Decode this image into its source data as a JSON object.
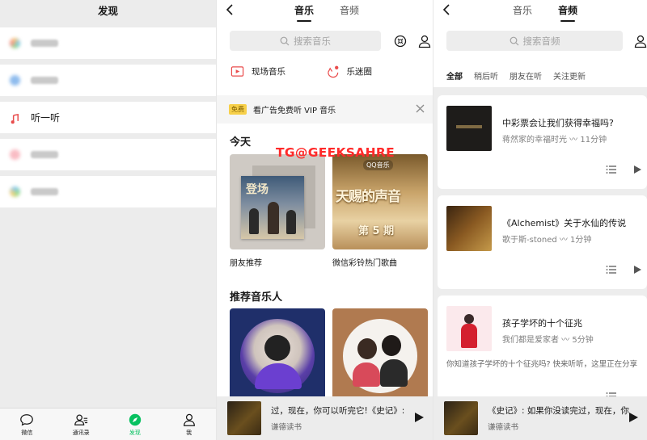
{
  "panel1": {
    "title": "发现",
    "row_label": "听一听",
    "tabbar": [
      {
        "label": "微信"
      },
      {
        "label": "通讯录"
      },
      {
        "label": "发现"
      },
      {
        "label": "我"
      }
    ]
  },
  "panel2": {
    "tabs": [
      "音乐",
      "音频"
    ],
    "search_placeholder": "搜索音乐",
    "quick": [
      "现场音乐",
      "乐迷圈"
    ],
    "ad": {
      "badge": "免费",
      "text": "看广告免费听 VIP 音乐"
    },
    "today_title": "今天",
    "cards": [
      {
        "label": "朋友推荐",
        "cover_text": "登场"
      },
      {
        "label": "微信彩铃热门歌曲",
        "cover_text": "天赐的声音",
        "cover_sub": "第 5 期",
        "cover_logo": "QQ音乐"
      }
    ],
    "artists_title": "推荐音乐人",
    "watermark": "TG@GEEKSAHRE",
    "player": {
      "title": "过，现在，你可以听完它!《史记》:",
      "subtitle": "谦德读书"
    }
  },
  "panel3": {
    "tabs": [
      "音乐",
      "音频"
    ],
    "search_placeholder": "搜索音频",
    "filters": [
      "全部",
      "稍后听",
      "朋友在听",
      "关注更新"
    ],
    "items": [
      {
        "title": "中彩票会让我们获得幸福吗?",
        "meta": "蒋然家的幸福时光 〰 11分钟"
      },
      {
        "title": "《Alchemist》关于水仙的传说",
        "meta": "歌于斯-stoned 〰 1分钟"
      },
      {
        "title": "孩子学坏的十个征兆",
        "meta": "我们都是爱家者 〰 5分钟",
        "desc": "你知道孩子学坏的十个征兆吗? 快来听听，这里正在分享"
      }
    ],
    "player": {
      "title": "《史记》: 如果你没读完过，现在，你",
      "subtitle": "谦德读书"
    }
  },
  "colors": {
    "accent_green": "#07c160",
    "watermark_red": "#ff2a2a",
    "ad_badge": "#f7d04a"
  }
}
